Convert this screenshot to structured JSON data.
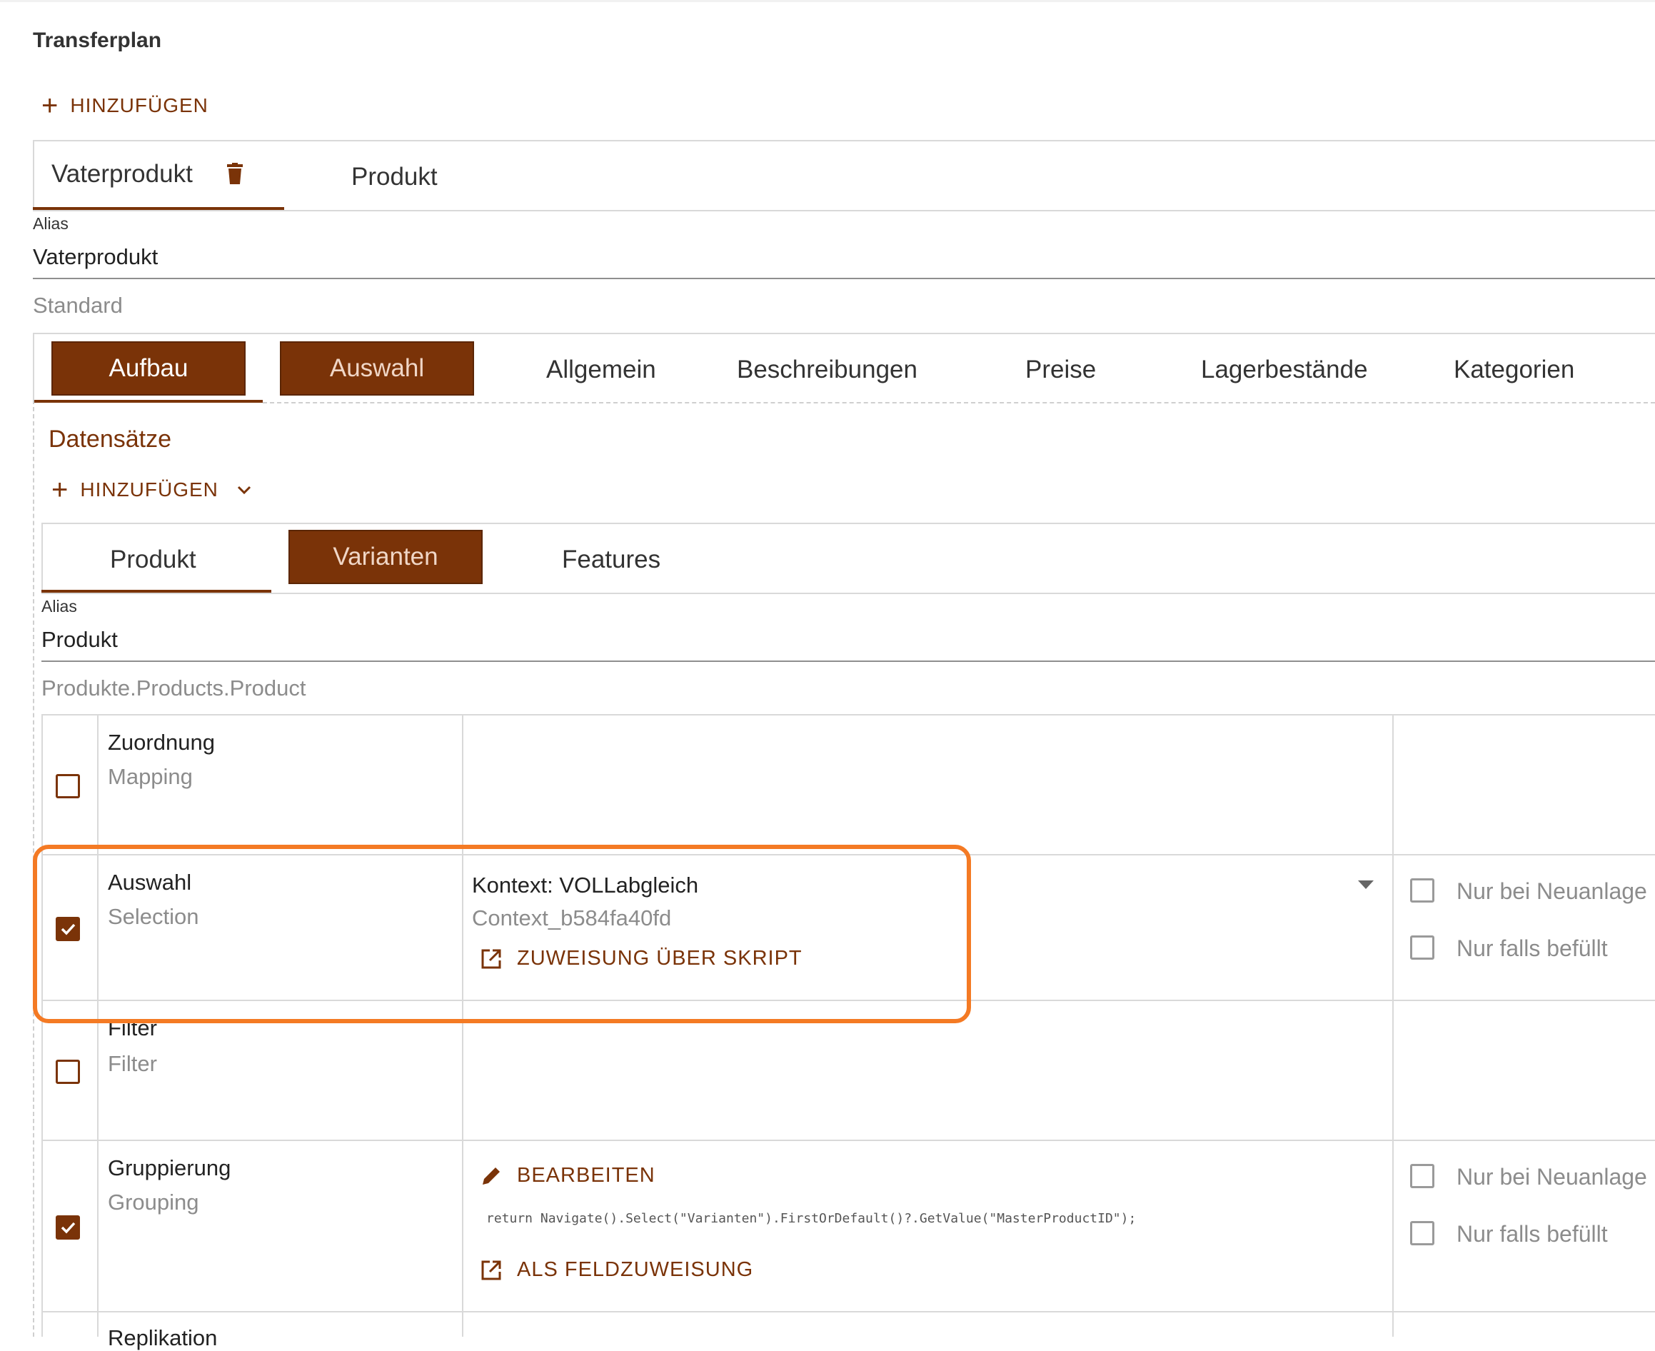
{
  "header": {
    "title": "Transferplan",
    "add_label": "HINZUFÜGEN"
  },
  "top_tabs": [
    {
      "label": "Vaterprodukt",
      "active": true,
      "icon": "trash-icon"
    },
    {
      "label": "Produkt",
      "active": false
    }
  ],
  "alias": {
    "label": "Alias",
    "value": "Vaterprodukt"
  },
  "type_text": "Standard",
  "section_tabs": [
    {
      "label": "Aufbau"
    },
    {
      "label": "Auswahl"
    },
    {
      "label": "Allgemein"
    },
    {
      "label": "Beschreibungen"
    },
    {
      "label": "Preise"
    },
    {
      "label": "Lagerbestände"
    },
    {
      "label": "Kategorien"
    }
  ],
  "datasets": {
    "title": "Datensätze",
    "add_label": "HINZUFÜGEN",
    "tabs": [
      {
        "label": "Produkt"
      },
      {
        "label": "Varianten"
      },
      {
        "label": "Features"
      }
    ],
    "alias": {
      "label": "Alias",
      "value": "Produkt"
    },
    "path": "Produkte.Products.Product"
  },
  "rows": {
    "zuordnung": {
      "title": "Zuordnung",
      "subtitle": "Mapping",
      "checked": false
    },
    "auswahl": {
      "title": "Auswahl",
      "subtitle": "Selection",
      "checked": true,
      "context_value": "Kontext: VOLLabgleich",
      "context_id": "Context_b584fa40fd",
      "action_label": "ZUWEISUNG ÜBER SKRIPT",
      "option_new": "Nur bei Neuanlage",
      "option_filled": "Nur falls befüllt"
    },
    "filter": {
      "title": "Filter",
      "subtitle": "Filter",
      "checked": false
    },
    "gruppierung": {
      "title": "Gruppierung",
      "subtitle": "Grouping",
      "checked": true,
      "edit_label": "BEARBEITEN",
      "code": "return Navigate().Select(\"Varianten\").FirstOrDefault()?.GetValue(\"MasterProductID\");",
      "action_label": "ALS FELDZUWEISUNG",
      "option_new": "Nur bei Neuanlage",
      "option_filled": "Nur falls befüllt"
    },
    "replikation": {
      "title": "Replikation"
    }
  },
  "colors": {
    "accent": "#7a3308",
    "highlight": "#f47a24"
  }
}
